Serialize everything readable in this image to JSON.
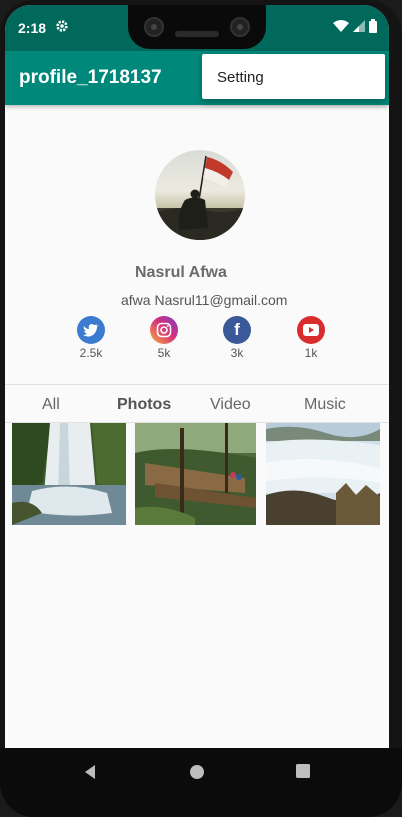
{
  "status_bar": {
    "time": "2:18",
    "icons": [
      "gear-icon",
      "wifi-icon",
      "signal-icon",
      "battery-icon"
    ]
  },
  "app_bar": {
    "title": "profile_1718137"
  },
  "overflow_menu": {
    "items": [
      {
        "label": "Setting"
      }
    ]
  },
  "profile": {
    "name": "Nasrul Afwa",
    "email": "afwa Nasrul11@gmail.com",
    "social": [
      {
        "network": "twitter",
        "icon": "twitter-icon",
        "count": "2.5k",
        "color": "#3b7bd0"
      },
      {
        "network": "instagram",
        "icon": "instagram-icon",
        "count": "5k",
        "color": "#d5307c"
      },
      {
        "network": "facebook",
        "icon": "facebook-icon",
        "count": "3k",
        "color": "#3b5998"
      },
      {
        "network": "youtube",
        "icon": "youtube-icon",
        "count": "1k",
        "color": "#d92c2c"
      }
    ]
  },
  "tabs": [
    {
      "label": "All",
      "active": false
    },
    {
      "label": "Photos",
      "active": true
    },
    {
      "label": "Video",
      "active": false
    },
    {
      "label": "Music",
      "active": false
    }
  ],
  "photos": [
    "waterfall photo",
    "forest walkway photo",
    "sea of clouds photo"
  ],
  "theme": {
    "primary": "#00897b",
    "primary_dark": "#00695c"
  }
}
